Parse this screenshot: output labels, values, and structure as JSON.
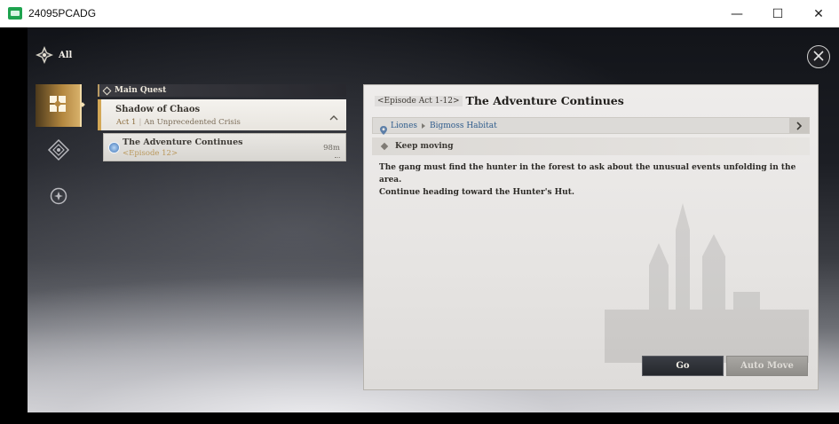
{
  "window": {
    "title": "24095PCADG",
    "controls": {
      "minimize": "—",
      "maximize": "☐",
      "close": "✕"
    }
  },
  "header": {
    "filter_label": "All"
  },
  "side_tabs": [
    {
      "icon": "quest-grid-icon",
      "active": true
    },
    {
      "icon": "compass-diamond-icon",
      "active": false
    },
    {
      "icon": "circle-star-icon",
      "active": false
    }
  ],
  "quest_list": {
    "category": "Main Quest",
    "group": {
      "title": "Shadow of Chaos",
      "act": "Act 1",
      "act_name": "An Unprecedented Crisis"
    },
    "items": [
      {
        "title": "The Adventure Continues",
        "episode": "<Episode 12>",
        "distance": "98m"
      }
    ]
  },
  "detail": {
    "episode_tag": "<Episode Act 1-12>",
    "title": "The Adventure Continues",
    "location": {
      "region": "Liones",
      "area": "Bigmoss Habitat"
    },
    "objective": "Keep moving",
    "description_line1": "The gang must find the hunter in the forest to ask about the unusual events unfolding in the area.",
    "description_line2": "Continue heading toward the Hunter's Hut.",
    "buttons": {
      "go": "Go",
      "auto_move": "Auto Move"
    }
  },
  "colors": {
    "accent_gold": "#d3a755",
    "location_blue": "#2f5c8c",
    "episode_gold": "#b9975a"
  }
}
